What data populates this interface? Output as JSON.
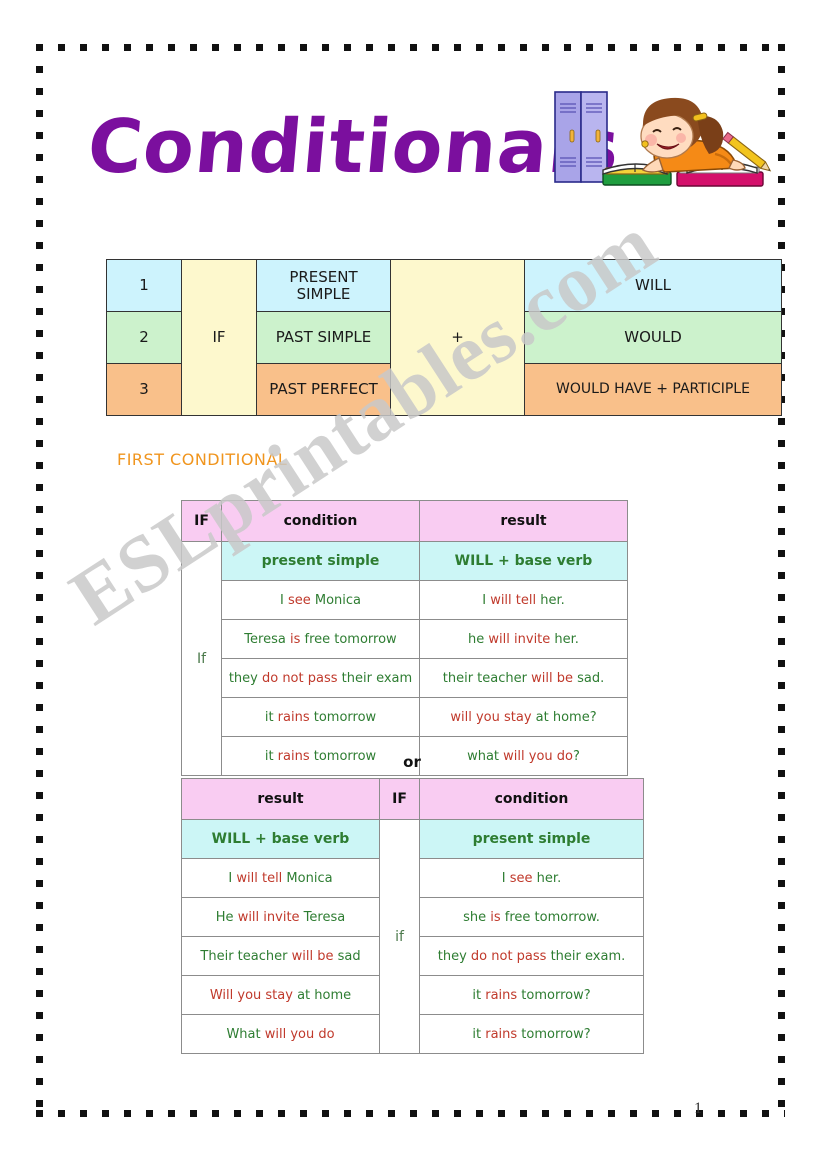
{
  "page": {
    "title": "Conditionals",
    "page_number": "1",
    "watermark": "ESLprintables.com",
    "title_color": "#7b0f9e",
    "heading_color": "#f0951e",
    "green_text_color": "#2e7d32",
    "red_text_color": "#c0392b"
  },
  "clipart": {
    "name": "girl-studying-at-desk-with-books-and-lockers"
  },
  "summary_table": {
    "if_label": "IF",
    "plus_label": "+",
    "rows": [
      {
        "number": "1",
        "tense": "PRESENT SIMPLE",
        "result": "WILL",
        "color": "#cdf3fd"
      },
      {
        "number": "2",
        "tense": "PAST SIMPLE",
        "result": "WOULD",
        "color": "#ccf2cc"
      },
      {
        "number": "3",
        "tense": "PAST PERFECT",
        "result": "WOULD HAVE + PARTICIPLE",
        "color": "#f9c08a"
      }
    ]
  },
  "section_heading": "FIRST CONDITIONAL",
  "or_label": "or",
  "table_first": {
    "headers": {
      "if": "IF",
      "condition": "condition",
      "result": "result"
    },
    "formula": {
      "condition": "present simple",
      "result": "WILL + base verb"
    },
    "if_cell": "If",
    "rows": [
      {
        "condition_parts": [
          {
            "text": "I ",
            "color": "green"
          },
          {
            "text": "see",
            "color": "red"
          },
          {
            "text": " Monica",
            "color": "green"
          }
        ],
        "condition_plain": "I see Monica",
        "result_parts": [
          {
            "text": "I ",
            "color": "green"
          },
          {
            "text": "will tell",
            "color": "red"
          },
          {
            "text": " her.",
            "color": "green"
          }
        ],
        "result_plain": "I will tell her."
      },
      {
        "condition_parts": [
          {
            "text": "Teresa ",
            "color": "green"
          },
          {
            "text": "is",
            "color": "red"
          },
          {
            "text": " free tomorrow",
            "color": "green"
          }
        ],
        "condition_plain": "Teresa is free tomorrow",
        "result_parts": [
          {
            "text": "he ",
            "color": "green"
          },
          {
            "text": "will invite",
            "color": "red"
          },
          {
            "text": " her.",
            "color": "green"
          }
        ],
        "result_plain": "he will invite her."
      },
      {
        "condition_parts": [
          {
            "text": "they ",
            "color": "green"
          },
          {
            "text": "do not pass",
            "color": "red"
          },
          {
            "text": " their exam",
            "color": "green"
          }
        ],
        "condition_plain": "they do not pass their exam",
        "result_parts": [
          {
            "text": "their teacher ",
            "color": "green"
          },
          {
            "text": "will be",
            "color": "red"
          },
          {
            "text": " sad.",
            "color": "green"
          }
        ],
        "result_plain": "their teacher will be sad."
      },
      {
        "condition_parts": [
          {
            "text": "it ",
            "color": "green"
          },
          {
            "text": "rains",
            "color": "red"
          },
          {
            "text": " tomorrow",
            "color": "green"
          }
        ],
        "condition_plain": "it rains tomorrow",
        "result_parts": [
          {
            "text": "will you stay",
            "color": "red"
          },
          {
            "text": " at home?",
            "color": "green"
          }
        ],
        "result_plain": "will you stay at home?"
      },
      {
        "condition_parts": [
          {
            "text": "it ",
            "color": "green"
          },
          {
            "text": "rains",
            "color": "red"
          },
          {
            "text": " tomorrow",
            "color": "green"
          }
        ],
        "condition_plain": "it rains tomorrow",
        "result_parts": [
          {
            "text": "what ",
            "color": "green"
          },
          {
            "text": "will you do",
            "color": "red"
          },
          {
            "text": "?",
            "color": "green"
          }
        ],
        "result_plain": "what will you do?"
      }
    ]
  },
  "table_second": {
    "headers": {
      "result": "result",
      "if": "IF",
      "condition": "condition"
    },
    "formula": {
      "result": "WILL + base verb",
      "condition": "present simple"
    },
    "if_cell": "if",
    "rows": [
      {
        "result_parts": [
          {
            "text": "I ",
            "color": "green"
          },
          {
            "text": "will tell",
            "color": "red"
          },
          {
            "text": " Monica",
            "color": "green"
          }
        ],
        "result_plain": "I will tell Monica",
        "condition_parts": [
          {
            "text": "I ",
            "color": "green"
          },
          {
            "text": "see",
            "color": "red"
          },
          {
            "text": " her.",
            "color": "green"
          }
        ],
        "condition_plain": "I see her."
      },
      {
        "result_parts": [
          {
            "text": "He ",
            "color": "green"
          },
          {
            "text": "will invite",
            "color": "red"
          },
          {
            "text": " Teresa",
            "color": "green"
          }
        ],
        "result_plain": "He will invite Teresa",
        "condition_parts": [
          {
            "text": "she ",
            "color": "green"
          },
          {
            "text": "is",
            "color": "red"
          },
          {
            "text": " free tomorrow.",
            "color": "green"
          }
        ],
        "condition_plain": "she is free tomorrow."
      },
      {
        "result_parts": [
          {
            "text": "Their teacher ",
            "color": "green"
          },
          {
            "text": "will be",
            "color": "red"
          },
          {
            "text": " sad",
            "color": "green"
          }
        ],
        "result_plain": "Their teacher will be sad",
        "condition_parts": [
          {
            "text": "they ",
            "color": "green"
          },
          {
            "text": "do not pass",
            "color": "red"
          },
          {
            "text": " their exam.",
            "color": "green"
          }
        ],
        "condition_plain": "they do not pass their exam."
      },
      {
        "result_parts": [
          {
            "text": "Will you stay",
            "color": "red"
          },
          {
            "text": " at home",
            "color": "green"
          }
        ],
        "result_plain": "Will you stay at home",
        "condition_parts": [
          {
            "text": "it ",
            "color": "green"
          },
          {
            "text": "rains",
            "color": "red"
          },
          {
            "text": " tomorrow?",
            "color": "green"
          }
        ],
        "condition_plain": "it rains tomorrow?"
      },
      {
        "result_parts": [
          {
            "text": "What ",
            "color": "green"
          },
          {
            "text": "will you do",
            "color": "red"
          },
          {
            "text": "",
            "color": "green"
          }
        ],
        "result_plain": "What will you do",
        "condition_parts": [
          {
            "text": "it ",
            "color": "green"
          },
          {
            "text": "rains",
            "color": "red"
          },
          {
            "text": " tomorrow?",
            "color": "green"
          }
        ],
        "condition_plain": "it rains tomorrow?"
      }
    ]
  }
}
